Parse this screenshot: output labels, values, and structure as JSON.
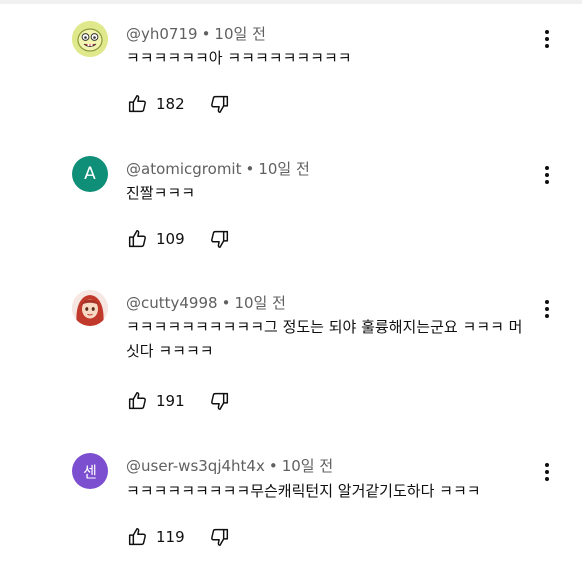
{
  "comments": [
    {
      "author": "@yh0719",
      "time": "10일 전",
      "text": "ㅋㅋㅋㅋㅋㅋ아 ㅋㅋㅋㅋㅋㅋㅋㅋㅋ",
      "likes": "182",
      "avatar_icon": "yellow-cartoon-avatar-icon",
      "avatar_color": "#dfe88a"
    },
    {
      "author": "@atomicgromit",
      "time": "10일 전",
      "text": "진짤ㅋㅋㅋ",
      "likes": "109",
      "avatar_letter": "A",
      "avatar_color": "#0f8f78"
    },
    {
      "author": "@cutty4998",
      "time": "10일 전",
      "text": "ㅋㅋㅋㅋㅋㅋㅋㅋㅋㅋ그 정도는 되야 훌륭해지는군요 ㅋㅋㅋ 머싯다 ㅋㅋㅋㅋ",
      "likes": "191",
      "avatar_icon": "red-haired-girl-avatar-icon",
      "avatar_color": "#c0392b"
    },
    {
      "author": "@user-ws3qj4ht4x",
      "time": "10일 전",
      "text": "ㅋㅋㅋㅋㅋㅋㅋㅋㅋ무슨캐릭턴지 알거같기도하다 ㅋㅋㅋ",
      "likes": "119",
      "avatar_letter": "센",
      "avatar_color": "#7b4fd0"
    }
  ],
  "separator": "•",
  "icons": {
    "like": "thumbs-up-icon",
    "dislike": "thumbs-down-icon",
    "menu": "more-vert-icon"
  }
}
